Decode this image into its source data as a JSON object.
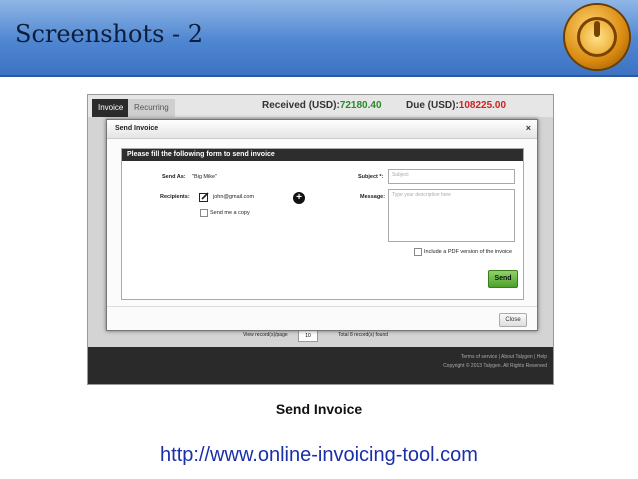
{
  "slide": {
    "title": "Screenshots - 2",
    "caption": "Send Invoice",
    "url": "http://www.online-invoicing-tool.com",
    "logo_icon": "power-logo-icon"
  },
  "app": {
    "tabs": [
      "Invoice",
      "Recurring"
    ],
    "received_label": "Received (USD):",
    "received_value": "72180.40",
    "due_label": "Due (USD):",
    "due_value": "108225.00",
    "pager_label": "View record(s)/page",
    "pager_value": "10",
    "records_found": "Total 8 record(s) found",
    "footer_links": "Terms of service | About Talygen | Help",
    "copyright": "Copyright © 2013 Talygen. All Rights Reserved"
  },
  "modal": {
    "title": "Send Invoice",
    "close_glyph": "×",
    "form_header": "Please fill the following form to send invoice",
    "send_as_label": "Send As:",
    "send_as_value": "\"Big Mike\"",
    "recipients_label": "Recipients:",
    "recipient_email": "john@gmail.com",
    "send_me_copy": "Send me a copy",
    "subject_label": "Subject *:",
    "subject_placeholder": "Subject",
    "message_label": "Message:",
    "message_placeholder": "Type your description here",
    "include_pdf": "Include a PDF version of the invoice",
    "send_button": "Send",
    "close_button": "Close"
  },
  "colors": {
    "banner": "#4f86d1",
    "received": "#2a8a2a",
    "due": "#cc2222",
    "send_button": "#5cb035",
    "url": "#1a2fa8"
  }
}
